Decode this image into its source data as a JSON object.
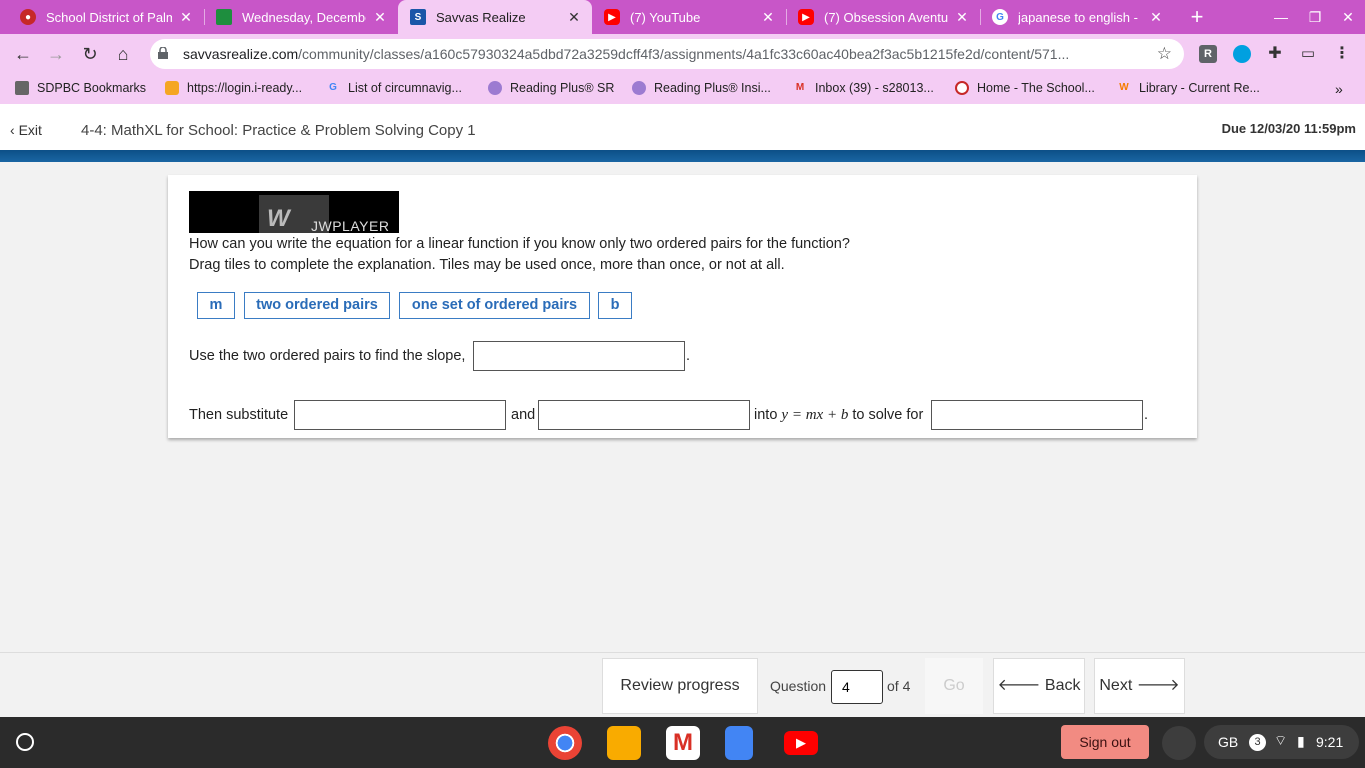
{
  "browser": {
    "tabs": [
      {
        "title": "School District of Palm",
        "icon": "school-district-icon",
        "color": "#c62828"
      },
      {
        "title": "Wednesday, December",
        "icon": "classroom-icon",
        "color": "#1e8e3e"
      },
      {
        "title": "Savvas Realize",
        "icon": "savvas-icon",
        "color": "#1a56a8"
      },
      {
        "title": "(7) YouTube",
        "icon": "youtube-icon",
        "color": "#ff0000"
      },
      {
        "title": "(7) Obsession Aventur",
        "icon": "youtube-icon",
        "color": "#ff0000"
      },
      {
        "title": "japanese to english - G",
        "icon": "google-icon",
        "color": "#4285f4"
      }
    ],
    "close_glyph": "✕",
    "new_tab_glyph": "+",
    "url_host": "savvasrealize.com",
    "url_path": "/community/classes/a160c57930324a5dbd72a3259dcff4f3/assignments/4a1fc33c60ac40bea2f3ac5b1215fe2d/content/571...",
    "bookmarks": [
      "SDPBC Bookmarks",
      "https://login.i-ready...",
      "List of circumnavig...",
      "Reading Plus® SR",
      "Reading Plus® Insi...",
      "Inbox (39) - s28013...",
      "Home - The School...",
      "Library - Current Re..."
    ],
    "bookmarks_more": "»",
    "ext_r": "R"
  },
  "header": {
    "exit_label": "Exit",
    "assignment_title": "4-4: MathXL for School: Practice & Problem Solving Copy 1",
    "due": "Due 12/03/20 11:59pm"
  },
  "video": {
    "brand": "JWPLAYER",
    "logo_mark": "W"
  },
  "question": {
    "line1": "How can you write the equation for a linear function if you know only two ordered pairs for the function?",
    "line2": "Drag tiles to complete the explanation. Tiles may be used once, more than once, or not at all.",
    "tiles": [
      "m",
      "two ordered pairs",
      "one set of ordered pairs",
      "b"
    ],
    "sentence1": "Use the two ordered pairs to find the slope,",
    "sentence2_a": "Then substitute",
    "sentence2_b": "and",
    "sentence2_c_pre": "into",
    "equation": "y = mx + b",
    "sentence2_c_post": "to solve for",
    "period": "."
  },
  "footer": {
    "review_label": "Review progress",
    "question_label": "Question",
    "question_value": "4",
    "of_label": "of 4",
    "go_label": "Go",
    "back_label": "Back",
    "next_label": "Next"
  },
  "shelf": {
    "sign_out": "Sign out",
    "keyboard": "GB",
    "notification_count": "3",
    "time": "9:21"
  }
}
